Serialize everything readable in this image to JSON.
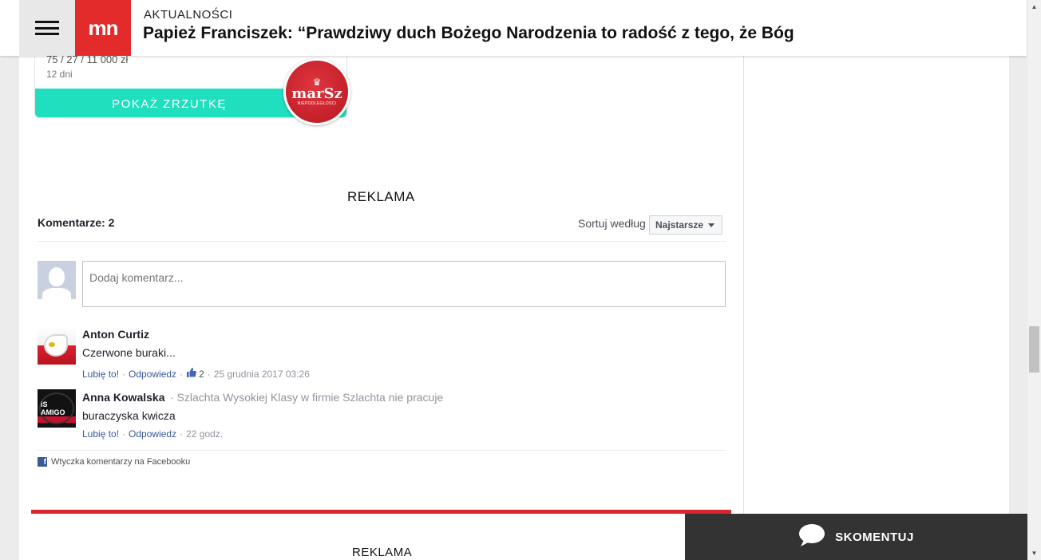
{
  "header": {
    "category": "AKTUALNOŚCI",
    "title": "Papież Franciszek: “Prawdziwy duch Bożego Narodzenia to radość z tego, że Bóg",
    "logo_text": "mn",
    "brand_color": "#e32b2b"
  },
  "zrzutka": {
    "amount_partial": "75 / 27 / 11 000 zł",
    "days_left": "12 dni",
    "button_label": "POKAŻ ZRZUTKĘ",
    "button_color": "#1fdfbe",
    "avatar_text": "marSz",
    "avatar_subtext": "NIEPODLEGŁOŚCI"
  },
  "ads": {
    "label_top": "REKLAMA",
    "label_bottom": "REKLAMA"
  },
  "comments": {
    "count_label": "Komentarze: 2",
    "sort_label": "Sortuj według",
    "sort_value": "Najstarsze",
    "input_placeholder": "Dodaj komentarz...",
    "items": [
      {
        "author": "Anton Curtiz",
        "meta": "",
        "text": "Czerwone buraki...",
        "like_label": "Lubię to!",
        "reply_label": "Odpowiedz",
        "likes": "2",
        "time": "25 grudnia 2017 03:26"
      },
      {
        "author": "Anna Kowalska",
        "meta": "· Szlachta Wysokiej Klasy w firmie Szlachta nie pracuje",
        "text": "buraczyska kwicza",
        "like_label": "Lubię to!",
        "reply_label": "Odpowiedz",
        "time": "22 godz."
      }
    ],
    "plugin_label": "Wtyczka komentarzy na Facebooku",
    "avatar2_text": "iS AMIGO"
  },
  "cta": {
    "label": "SKOMENTUJ",
    "icon": "speech-bubble-icon"
  },
  "colors": {
    "accent_red": "#d7262f",
    "link_blue": "#385898",
    "cta_bg": "#333333"
  }
}
